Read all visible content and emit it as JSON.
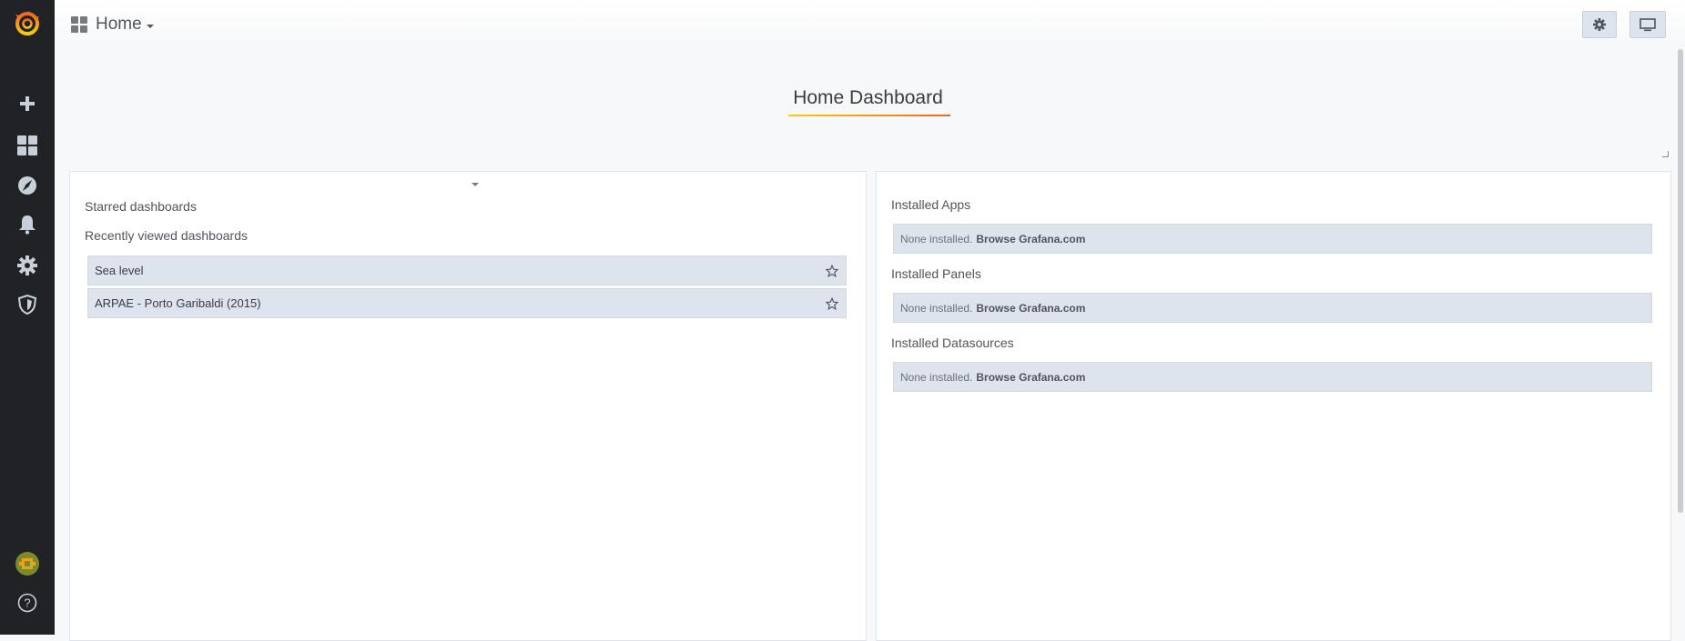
{
  "header": {
    "dashboard_picker_label": "Home",
    "dashboard_icon": "dashboard-grid-icon",
    "settings_icon": "gear-icon",
    "tv_icon": "monitor-icon"
  },
  "sidebar": {
    "logo": "grafana-logo",
    "items": [
      {
        "icon": "plus-icon",
        "name": "create"
      },
      {
        "icon": "dashboards-grid-icon",
        "name": "dashboards"
      },
      {
        "icon": "compass-icon",
        "name": "explore"
      },
      {
        "icon": "bell-icon",
        "name": "alerting"
      },
      {
        "icon": "gear-icon",
        "name": "configuration"
      },
      {
        "icon": "shield-icon",
        "name": "server-admin"
      }
    ],
    "bottom": [
      {
        "icon": "avatar",
        "name": "profile"
      },
      {
        "icon": "help-circle-icon",
        "name": "help"
      }
    ]
  },
  "main": {
    "title": "Home Dashboard",
    "left_panel": {
      "starred_heading": "Starred dashboards",
      "recent_heading": "Recently viewed dashboards",
      "recent": [
        {
          "label": "Sea level"
        },
        {
          "label": "ARPAE - Porto Garibaldi (2015)"
        }
      ]
    },
    "right_panel": {
      "sections": [
        {
          "heading": "Installed Apps",
          "none_text": "None installed.",
          "link_text": "Browse Grafana.com"
        },
        {
          "heading": "Installed Panels",
          "none_text": "None installed.",
          "link_text": "Browse Grafana.com"
        },
        {
          "heading": "Installed Datasources",
          "none_text": "None installed.",
          "link_text": "Browse Grafana.com"
        }
      ]
    }
  },
  "colors": {
    "sidebar_bg": "#202226",
    "accent_start": "#fbca0a",
    "accent_end": "#ec6726",
    "item_bg": "#dde4ed"
  }
}
